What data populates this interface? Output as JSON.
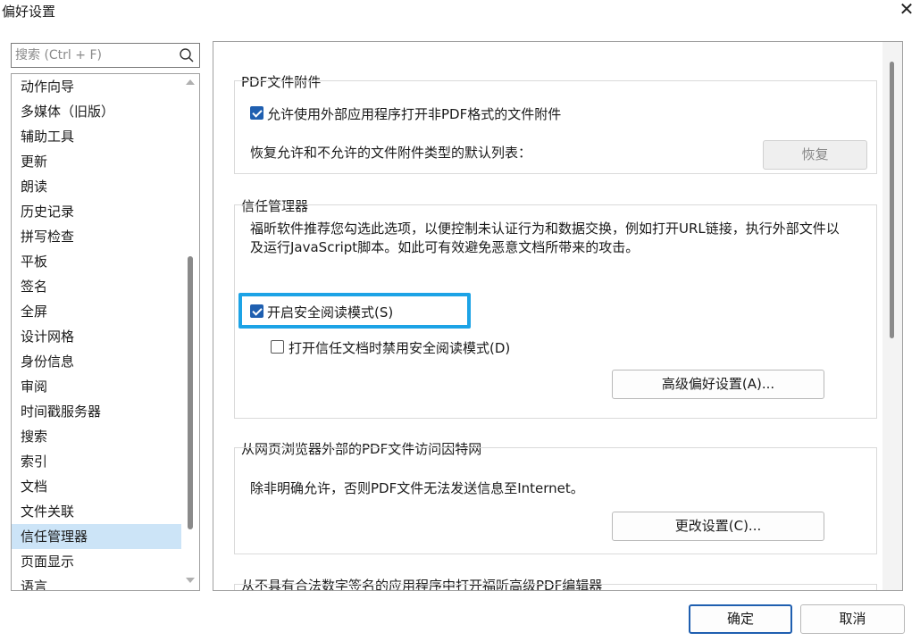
{
  "window": {
    "title": "偏好设置",
    "close_glyph": "✕"
  },
  "search": {
    "placeholder": "搜索 (Ctrl + F)",
    "value": ""
  },
  "nav": {
    "items": [
      "动作向导",
      "多媒体（旧版）",
      "辅助工具",
      "更新",
      "朗读",
      "历史记录",
      "拼写检查",
      "平板",
      "签名",
      "全屏",
      "设计网格",
      "身份信息",
      "审阅",
      "时间戳服务器",
      "搜索",
      "索引",
      "文档",
      "文件关联",
      "信任管理器",
      "页面显示",
      "语言"
    ],
    "selected": "信任管理器"
  },
  "pdf_attachments": {
    "label": "PDF文件附件",
    "allow_checkbox_label": "允许使用外部应用程序打开非PDF格式的文件附件",
    "allow_checked": true,
    "restore_text": "恢复允许和不允许的文件附件类型的默认列表：",
    "restore_button": "恢复"
  },
  "trust_manager": {
    "label": "信任管理器",
    "description": "福昕软件推荐您勾选此选项，以便控制未认证行为和数据交换，例如打开URL链接，执行外部文件以及运行JavaScript脚本。如此可有效避免恶意文档所带来的攻击。",
    "safe_mode_label": "开启安全阅读模式(S)",
    "safe_mode_checked": true,
    "disable_for_trusted_label": "打开信任文档时禁用安全阅读模式(D)",
    "disable_for_trusted_checked": false,
    "advanced_button": "高级偏好设置(A)..."
  },
  "internet_access": {
    "label": "从网页浏览器外部的PDF文件访问因特网",
    "description": "除非明确允许，否则PDF文件无法发送信息至Internet。",
    "change_button": "更改设置(C)..."
  },
  "unsigned_apps": {
    "label": "从不具有合法数字签名的应用程序中打开福昕高级PDF编辑器"
  },
  "footer": {
    "ok_button": "确定",
    "cancel_button": "取消"
  }
}
